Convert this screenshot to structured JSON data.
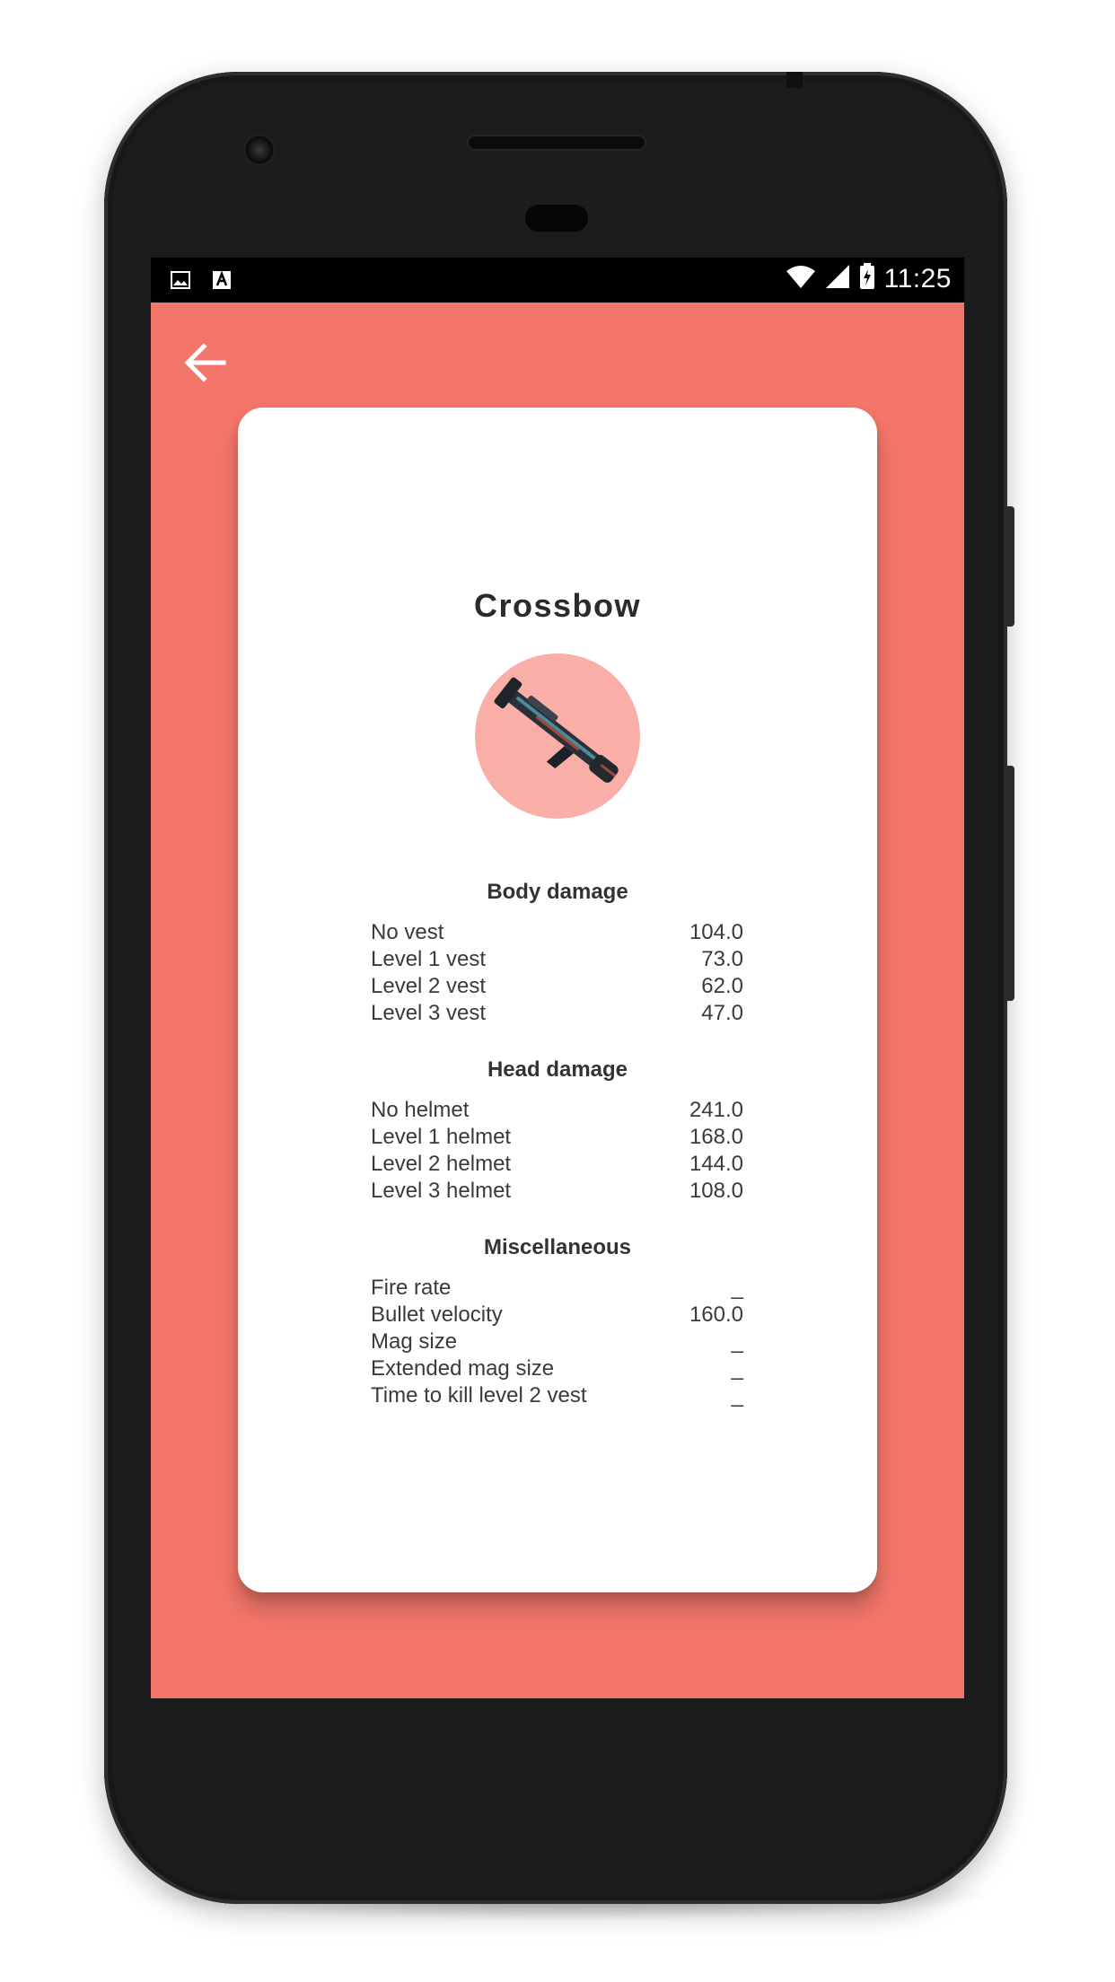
{
  "status_bar": {
    "time": "11:25",
    "left_icons": [
      "image-icon",
      "a-icon"
    ],
    "right_icons": [
      "wifi-icon",
      "signal-icon",
      "battery-charging-icon"
    ]
  },
  "app": {
    "background_color": "#f4766a",
    "back_icon": "arrow-left-icon"
  },
  "weapon": {
    "name": "Crossbow",
    "image_icon": "crossbow-image",
    "image_bg_color": "#f9aea7"
  },
  "sections": [
    {
      "title": "Body damage",
      "rows": [
        {
          "label": "No vest",
          "value": "104.0"
        },
        {
          "label": "Level 1 vest",
          "value": "73.0"
        },
        {
          "label": "Level 2 vest",
          "value": "62.0"
        },
        {
          "label": "Level 3 vest",
          "value": "47.0"
        }
      ]
    },
    {
      "title": "Head damage",
      "rows": [
        {
          "label": "No helmet",
          "value": "241.0"
        },
        {
          "label": "Level 1 helmet",
          "value": "168.0"
        },
        {
          "label": "Level 2 helmet",
          "value": "144.0"
        },
        {
          "label": "Level 3 helmet",
          "value": "108.0"
        }
      ]
    },
    {
      "title": "Miscellaneous",
      "rows": [
        {
          "label": "Fire rate",
          "value": "_"
        },
        {
          "label": "Bullet velocity",
          "value": "160.0"
        },
        {
          "label": "Mag size",
          "value": "_"
        },
        {
          "label": "Extended mag size",
          "value": "_"
        },
        {
          "label": "Time to kill level 2 vest",
          "value": "_"
        }
      ]
    }
  ]
}
